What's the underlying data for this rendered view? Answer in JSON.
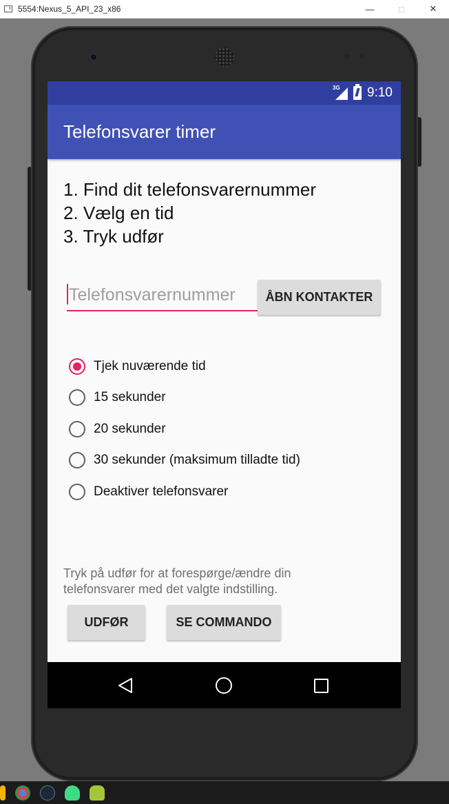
{
  "window": {
    "title": "5554:Nexus_5_API_23_x86",
    "minimize_glyph": "—",
    "maximize_glyph": "□",
    "close_glyph": "✕"
  },
  "statusbar": {
    "network": "3G",
    "time": "9:10"
  },
  "appbar": {
    "title": "Telefonsvarer timer"
  },
  "instructions": [
    "1. Find dit telefonsvarernummer",
    "2. Vælg en tid",
    "3. Tryk udfør"
  ],
  "phone_input": {
    "value": "",
    "placeholder": "Telefonsvarernummer"
  },
  "contacts_button": {
    "label": "ÅBN KONTAKTER"
  },
  "radio_options": [
    {
      "label": "Tjek nuværende tid",
      "checked": true
    },
    {
      "label": "15 sekunder",
      "checked": false
    },
    {
      "label": "20 sekunder",
      "checked": false
    },
    {
      "label": "30 sekunder (maksimum tilladte tid)",
      "checked": false
    },
    {
      "label": "Deaktiver telefonsvarer",
      "checked": false
    }
  ],
  "hint": "Tryk på udfør for at forespørge/ændre din telefonsvarer med det valgte indstilling.",
  "buttons": {
    "execute": "UDFØR",
    "show_command": "SE COMMANDO"
  },
  "colors": {
    "primary": "#3f51b5",
    "primary_dark": "#303f9f",
    "accent": "#e91e63"
  },
  "taskbar_icons": [
    "windows-logo-icon",
    "chrome-icon",
    "steam-icon",
    "android-studio-icon",
    "android-emulator-icon"
  ]
}
